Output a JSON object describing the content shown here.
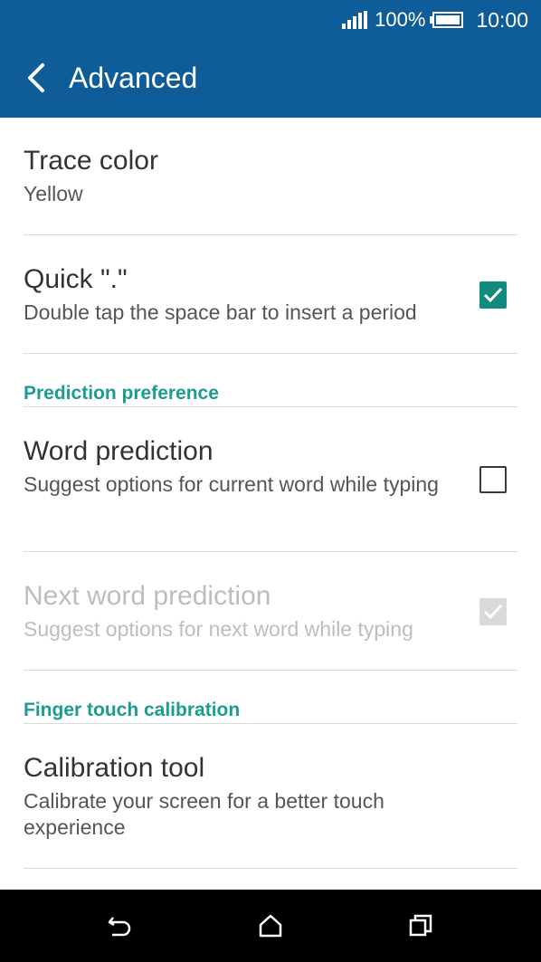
{
  "status": {
    "battery": "100%",
    "time": "10:00"
  },
  "appbar": {
    "title": "Advanced"
  },
  "items": {
    "trace_color": {
      "title": "Trace color",
      "subtitle": "Yellow"
    },
    "quick_period": {
      "title": "Quick \".\"",
      "subtitle": "Double tap the space bar to insert a period",
      "checked": true
    },
    "word_prediction": {
      "title": "Word prediction",
      "subtitle": "Suggest options for current word while typing",
      "checked": false
    },
    "next_word_prediction": {
      "title": "Next word prediction",
      "subtitle": "Suggest options for next word while typing",
      "checked": true,
      "enabled": false
    },
    "calibration_tool": {
      "title": "Calibration tool",
      "subtitle": "Calibrate your screen for a better touch experience"
    }
  },
  "sections": {
    "prediction": "Prediction preference",
    "calibration": "Finger touch calibration"
  },
  "colors": {
    "header": "#0e5d99",
    "accent": "#118a7e",
    "section_text": "#1a9c8e"
  },
  "icons": {
    "back": "chevron-left-icon",
    "signal": "signal-icon",
    "battery": "battery-icon",
    "nav_back": "back-arrow-icon",
    "nav_home": "home-icon",
    "nav_recents": "recents-icon"
  }
}
